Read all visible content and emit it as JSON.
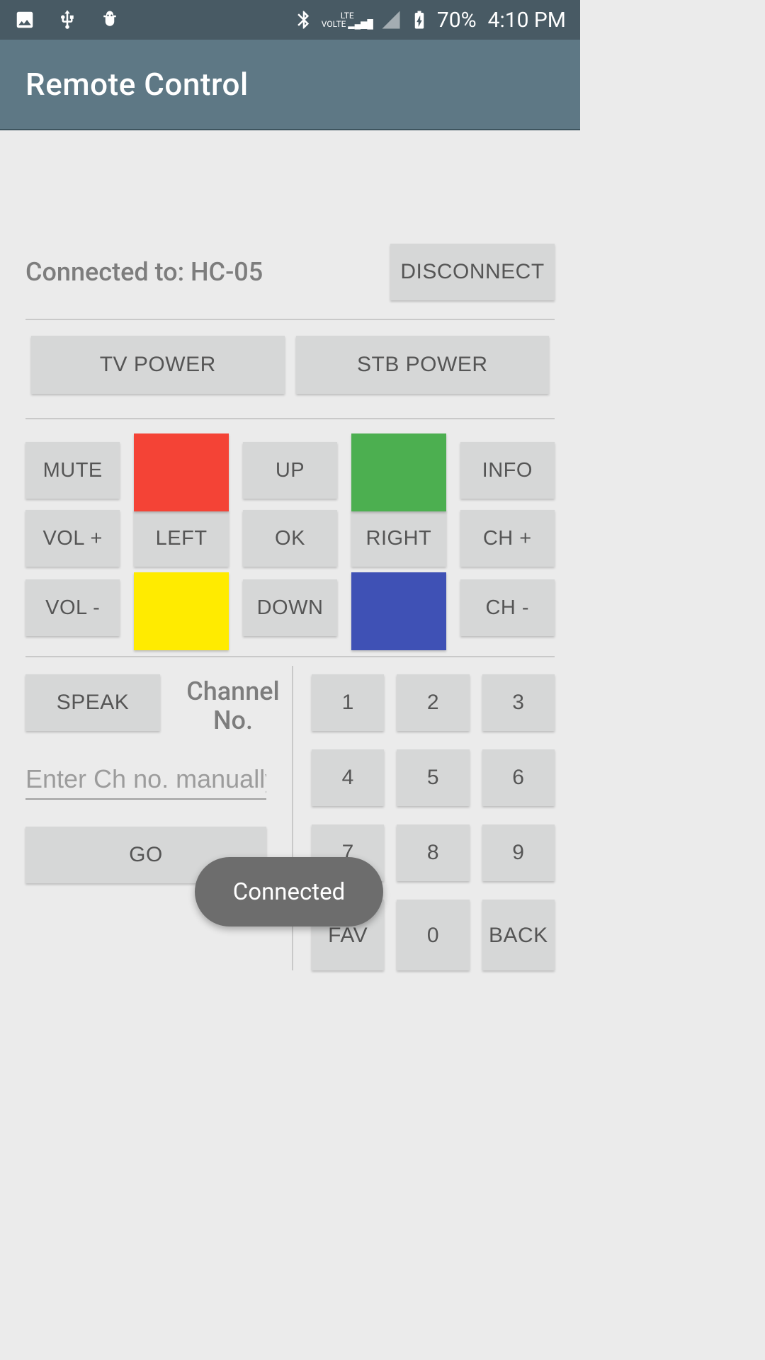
{
  "status": {
    "battery_percent": "70%",
    "time": "4:10 PM",
    "network_label": "LTE VOLTE"
  },
  "header": {
    "title": "Remote Control"
  },
  "connection": {
    "label": "Connected to: HC-05",
    "disconnect": "DISCONNECT"
  },
  "power": {
    "tv": "TV POWER",
    "stb": "STB POWER"
  },
  "dpad": {
    "mute": "MUTE",
    "up": "UP",
    "info": "INFO",
    "vol_up": "VOL +",
    "left": "LEFT",
    "ok": "OK",
    "right": "RIGHT",
    "ch_up": "CH +",
    "vol_down": "VOL -",
    "down": "DOWN",
    "ch_down": "CH -"
  },
  "colors": {
    "red": "#F44336",
    "green": "#4CAF50",
    "yellow": "#FFEB00",
    "blue": "#3F51B5"
  },
  "channel": {
    "speak": "SPEAK",
    "label": "Channel No.",
    "placeholder": "Enter Ch no. manually",
    "go": "GO"
  },
  "numpad": {
    "1": "1",
    "2": "2",
    "3": "3",
    "4": "4",
    "5": "5",
    "6": "6",
    "7": "7",
    "8": "8",
    "9": "9",
    "fav": "FAV",
    "0": "0",
    "back": "BACK"
  },
  "toast": {
    "message": "Connected"
  }
}
